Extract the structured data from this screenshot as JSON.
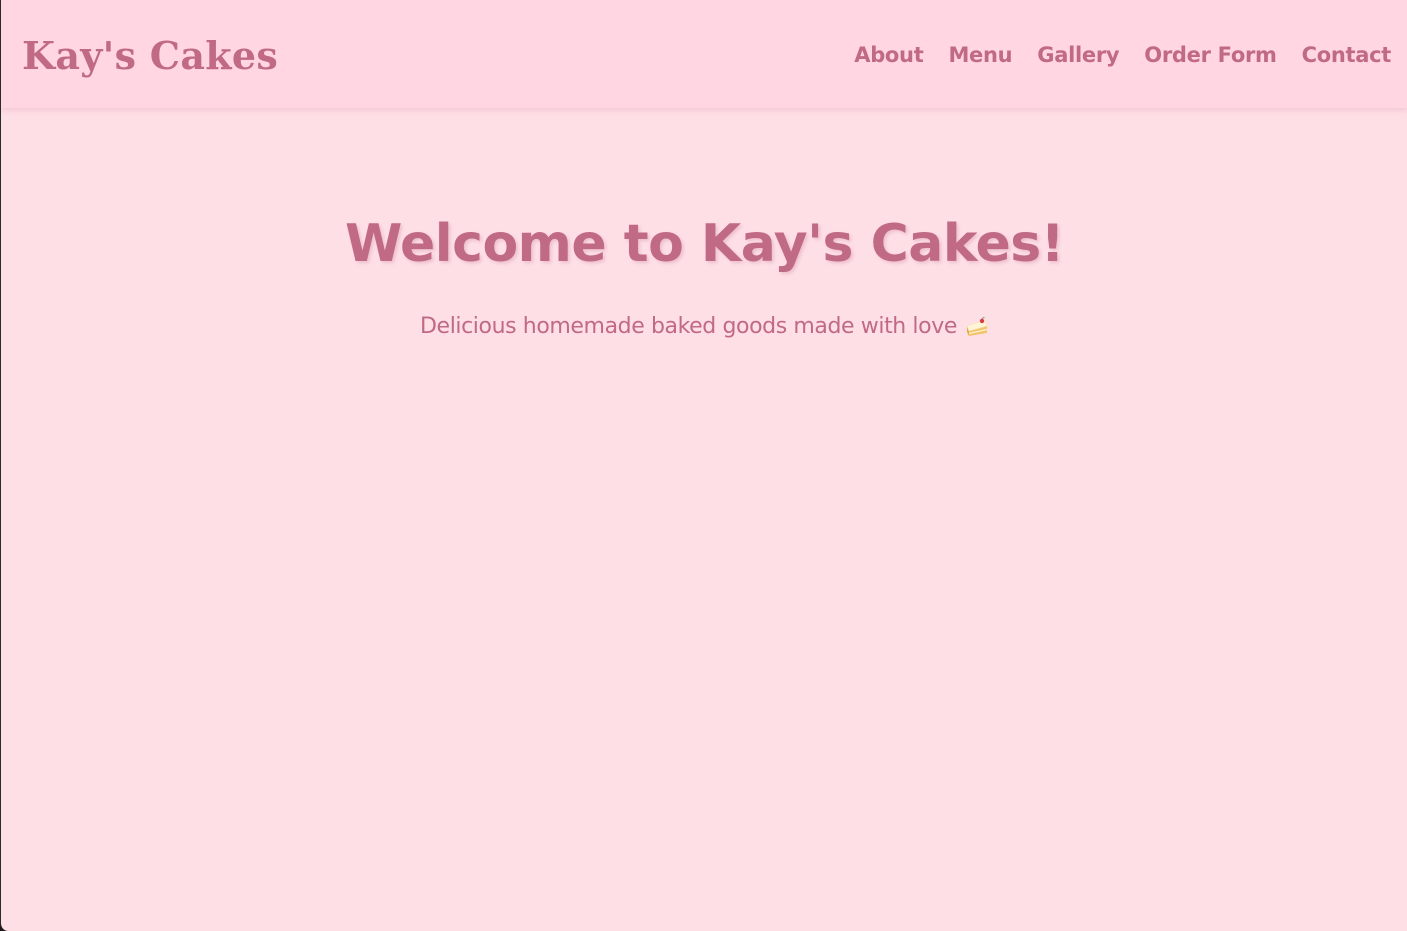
{
  "header": {
    "logo": "Kay's Cakes",
    "nav": [
      {
        "label": "About"
      },
      {
        "label": "Menu"
      },
      {
        "label": "Gallery"
      },
      {
        "label": "Order Form"
      },
      {
        "label": "Contact"
      }
    ]
  },
  "hero": {
    "title": "Welcome to Kay's Cakes!",
    "subtitle": "Delicious homemade baked goods made with love",
    "subtitle_icon": "cake-slice-icon"
  },
  "colors": {
    "background": "#ffdfe6",
    "header_background": "#ffd6e2",
    "accent_text": "#c06a85"
  }
}
